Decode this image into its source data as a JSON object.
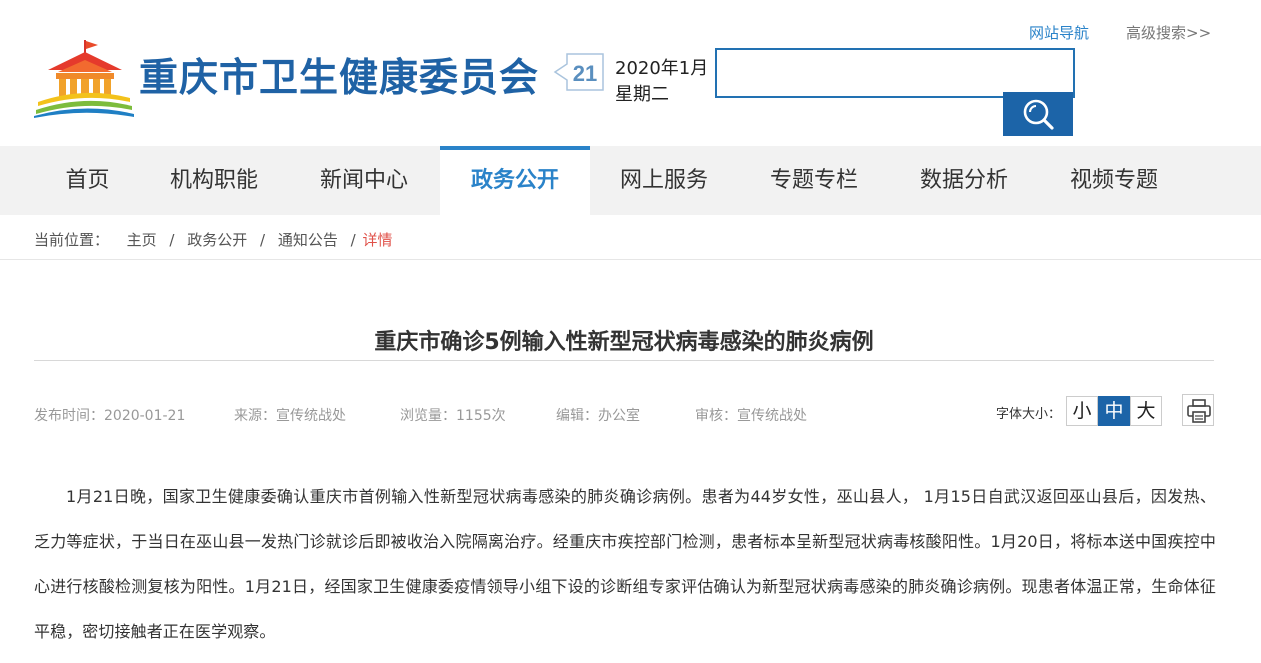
{
  "header": {
    "site_title": "重庆市卫生健康委员会",
    "date_day": "21",
    "date_line1": "2020年1月",
    "date_line2": "星期二",
    "links": {
      "site_nav": "网站导航",
      "advanced_search": "高级搜索>>"
    },
    "search": {
      "value": "",
      "placeholder": ""
    }
  },
  "nav": {
    "items": [
      {
        "label": "首页",
        "active": false
      },
      {
        "label": "机构职能",
        "active": false
      },
      {
        "label": "新闻中心",
        "active": false
      },
      {
        "label": "政务公开",
        "active": true
      },
      {
        "label": "网上服务",
        "active": false
      },
      {
        "label": "专题专栏",
        "active": false
      },
      {
        "label": "数据分析",
        "active": false
      },
      {
        "label": "视频专题",
        "active": false
      }
    ]
  },
  "breadcrumb": {
    "prefix": "当前位置：",
    "items": [
      "主页",
      "政务公开",
      "通知公告"
    ],
    "current": "详情",
    "separator": "/"
  },
  "article": {
    "title": "重庆市确诊5例输入性新型冠状病毒感染的肺炎病例",
    "meta": {
      "published": "发布时间：2020-01-21",
      "source": "来源：宣传统战处",
      "views": "浏览量：1155次",
      "editor": "编辑：办公室",
      "reviewer": "审核：宣传统战处"
    },
    "font_size": {
      "label": "字体大小：",
      "small": "小",
      "medium": "中",
      "large": "大",
      "selected": "中"
    },
    "body": "1月21日晚，国家卫生健康委确认重庆市首例输入性新型冠状病毒感染的肺炎确诊病例。患者为44岁女性，巫山县人， 1月15日自武汉返回巫山县后，因发热、乏力等症状，于当日在巫山县一发热门诊就诊后即被收治入院隔离治疗。经重庆市疾控部门检测，患者标本呈新型冠状病毒核酸阳性。1月20日，将标本送中国疾控中心进行核酸检测复核为阳性。1月21日，经国家卫生健康委疫情领导小组下设的诊断组专家评估确认为新型冠状病毒感染的肺炎确诊病例。现患者体温正常，生命体征平稳，密切接触者正在医学观察。"
  },
  "colors": {
    "brand_blue": "#1f62a5",
    "nav_active": "#2a83c9",
    "breadcrumb_current": "#e0524a",
    "nav_background": "#f2f2f2"
  },
  "icons": {
    "logo": "city-hall-logo-icon",
    "search": "search-icon",
    "print": "printer-icon"
  }
}
